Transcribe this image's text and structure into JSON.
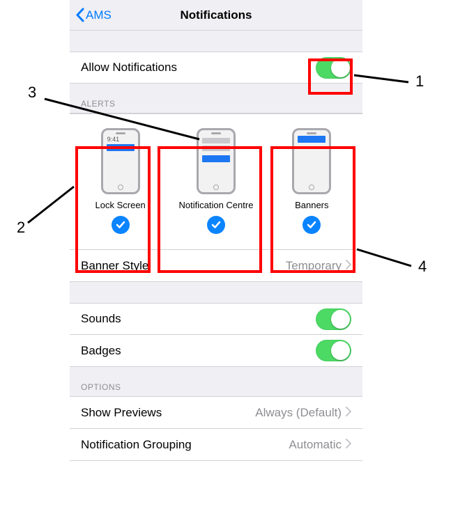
{
  "nav": {
    "back_label": "AMS",
    "title": "Notifications"
  },
  "allow_notifications": {
    "label": "Allow Notifications",
    "on": true
  },
  "alerts": {
    "header": "ALERTS",
    "items": [
      {
        "label": "Lock Screen",
        "checked": true,
        "preview": "lock",
        "time": "9:41"
      },
      {
        "label": "Notification Centre",
        "checked": true,
        "preview": "centre"
      },
      {
        "label": "Banners",
        "checked": true,
        "preview": "banner"
      }
    ],
    "banner_style": {
      "label": "Banner Style",
      "value": "Temporary"
    }
  },
  "sounds": {
    "label": "Sounds",
    "on": true
  },
  "badges": {
    "label": "Badges",
    "on": true
  },
  "options": {
    "header": "OPTIONS",
    "show_previews": {
      "label": "Show Previews",
      "value": "Always (Default)"
    },
    "grouping": {
      "label": "Notification Grouping",
      "value": "Automatic"
    }
  },
  "annotations": [
    "1",
    "2",
    "3",
    "4"
  ]
}
